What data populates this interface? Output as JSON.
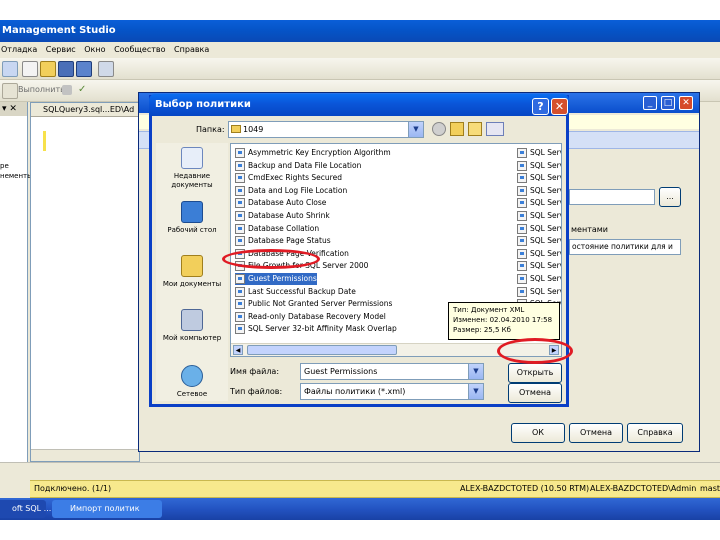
{
  "ssms": {
    "title": "Management Studio",
    "menu": [
      "Отладка",
      "Сервис",
      "Окно",
      "Сообщество",
      "Справка"
    ],
    "execute_label": "Выполнить",
    "editor_tab": "SQLQuery3.sql...ED\\Ad",
    "left_pane_text": [
      "ре",
      "нементы"
    ],
    "status_connected": "Подключено. (1/1)",
    "status_server": "ALEX-BAZDCTOTED (10.50 RTM)",
    "status_user": "ALEX-BAZDCTOTED\\Admin",
    "status_master": "maste"
  },
  "bg_dialog": {
    "browse_label": "...",
    "conditions_text": "ментами",
    "dropdown_value": "остояние политики для и",
    "ok_label": "ОК",
    "cancel_label": "Отмена",
    "help_label": "Справка"
  },
  "taskbar": {
    "items": [
      "oft SQL ...",
      "Импорт политик"
    ]
  },
  "dialog": {
    "title": "Выбор политики",
    "help_btn": "?",
    "close_btn": "✕",
    "look_in_label": "Папка:",
    "look_in_value": "1049",
    "places": [
      {
        "label": "Недавние документы",
        "icon": "recent-documents-icon"
      },
      {
        "label": "Рабочий стол",
        "icon": "desktop-icon"
      },
      {
        "label": "Мои документы",
        "icon": "my-documents-icon"
      },
      {
        "label": "Мой компьютер",
        "icon": "my-computer-icon"
      },
      {
        "label": "Сетевое",
        "icon": "network-icon"
      }
    ],
    "files": [
      "Asymmetric Key Encryption Algorithm",
      "Backup and Data File Location",
      "CmdExec Rights Secured",
      "Data and Log File Location",
      "Database Auto Close",
      "Database Auto Shrink",
      "Database Collation",
      "Database Page Status",
      "Database Page Verification",
      "File Growth for SQL Server 2000",
      "Guest Permissions",
      "Last Successful Backup Date",
      "Public Not Granted Server Permissions",
      "Read-only Database Recovery Model",
      "SQL Server 32-bit Affinity Mask Overlap"
    ],
    "selected_file": "Guest Permissions",
    "right_column": [
      "SQL Serve",
      "SQL Serve",
      "SQL Serve",
      "SQL Serve",
      "SQL Serve",
      "SQL Serve",
      "SQL Serve",
      "SQL Serve",
      "SQL Serve",
      "SQL Serve",
      "SQL Serve",
      "SQL Serve",
      "SQL Serve"
    ],
    "tooltip": {
      "type": "Тип: Документ XML",
      "modified": "Изменен: 02.04.2010 17:58",
      "size": "Размер: 25,5 Кб"
    },
    "filename_label": "Имя файла:",
    "filename_value": "Guest Permissions",
    "filetype_label": "Тип файлов:",
    "filetype_value": "Файлы политики (*.xml)",
    "open_label": "Открыть",
    "cancel_label": "Отмена"
  },
  "colors": {
    "highlight": "#e01b24",
    "selection": "#316ac5"
  }
}
